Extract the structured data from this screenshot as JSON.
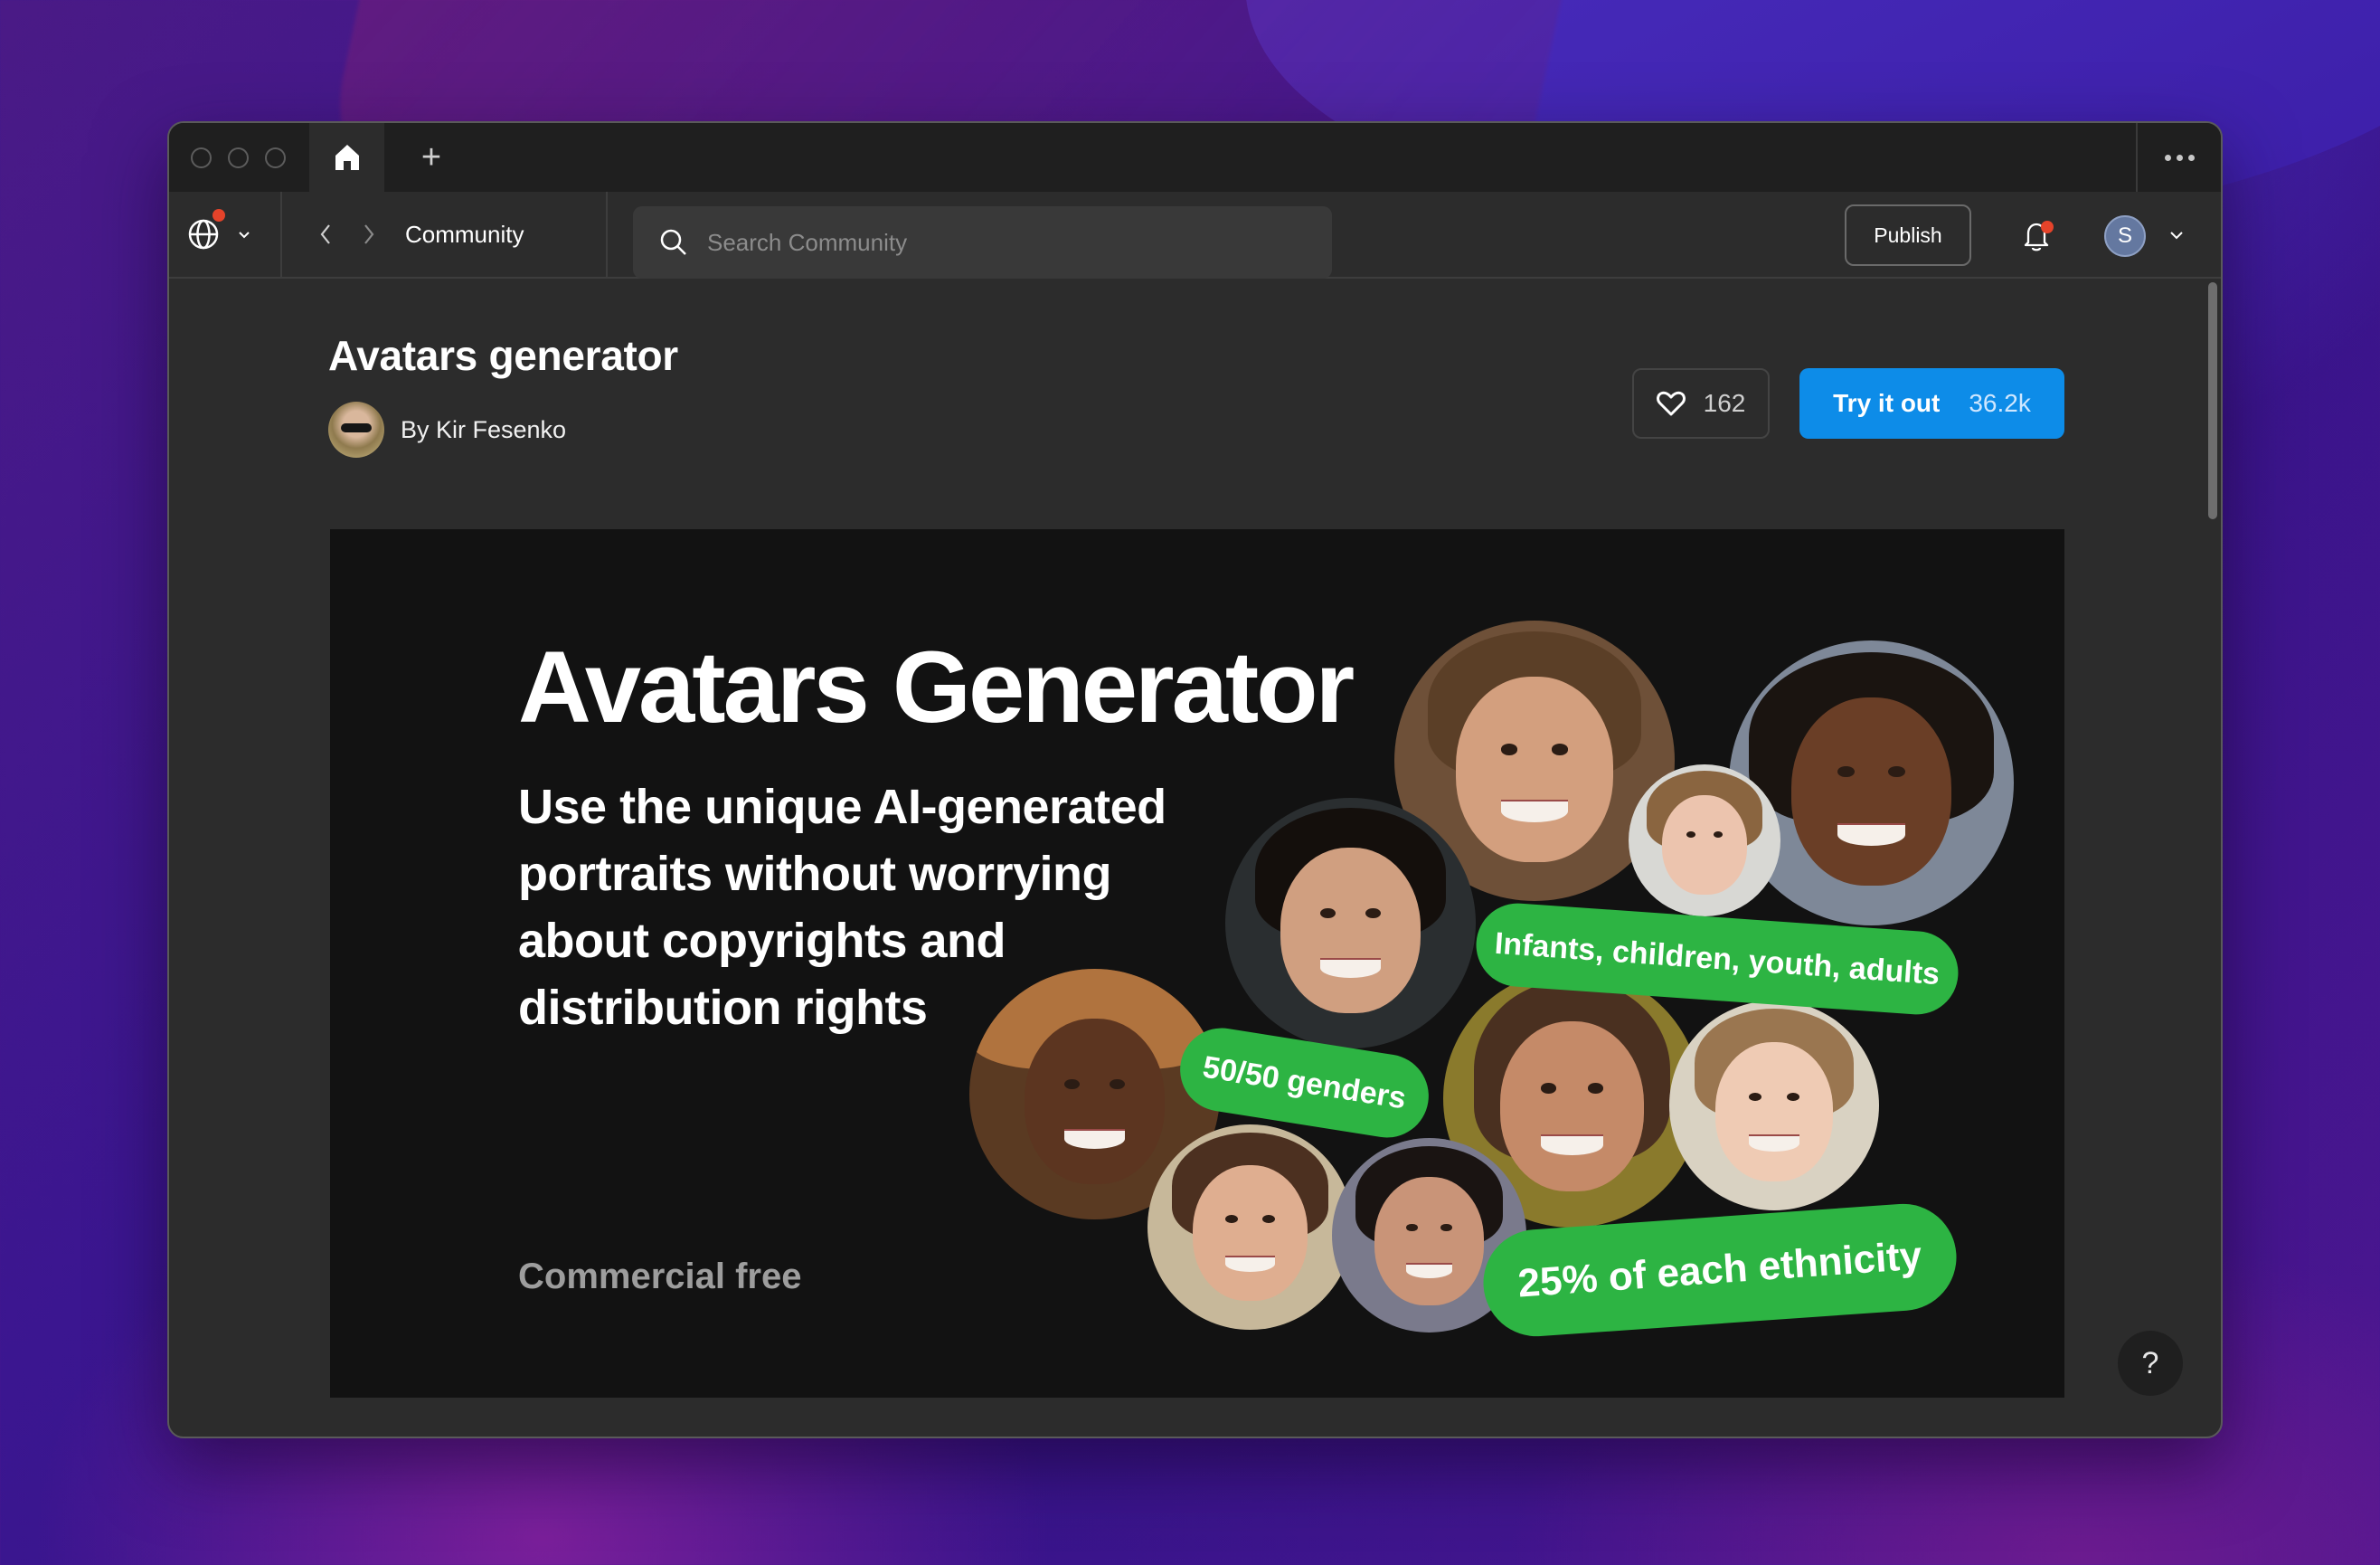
{
  "window": {
    "tabs": [
      {
        "name": "home",
        "icon": "home-icon"
      }
    ],
    "new_tab_label": "+",
    "more_icon": "more-horizontal-icon"
  },
  "toolbar": {
    "globe_icon": "globe-icon",
    "globe_has_notification": true,
    "breadcrumb": "Community",
    "search": {
      "placeholder": "Search Community",
      "value": ""
    },
    "publish_label": "Publish",
    "bell_has_notification": true,
    "user_initial": "S"
  },
  "plugin": {
    "title": "Avatars generator",
    "author": "By Kir Fesenko",
    "likes": "162",
    "try_label": "Try it out",
    "try_count": "36.2k"
  },
  "banner": {
    "title": "Avatars Generator",
    "description": "Use the unique AI-generated portraits without worrying about copyrights and distribution rights",
    "footer": "Commercial free",
    "pills": [
      "Infants, children, youth, adults",
      "50/50 genders",
      "25% of each ethnicity"
    ]
  },
  "help_label": "?",
  "colors": {
    "accent": "#0d8ce8",
    "pill_green": "#2db443",
    "notification": "#e5432a",
    "window_bg": "#2c2c2c",
    "titlebar_bg": "#1f1f1f",
    "banner_bg": "#121212"
  }
}
